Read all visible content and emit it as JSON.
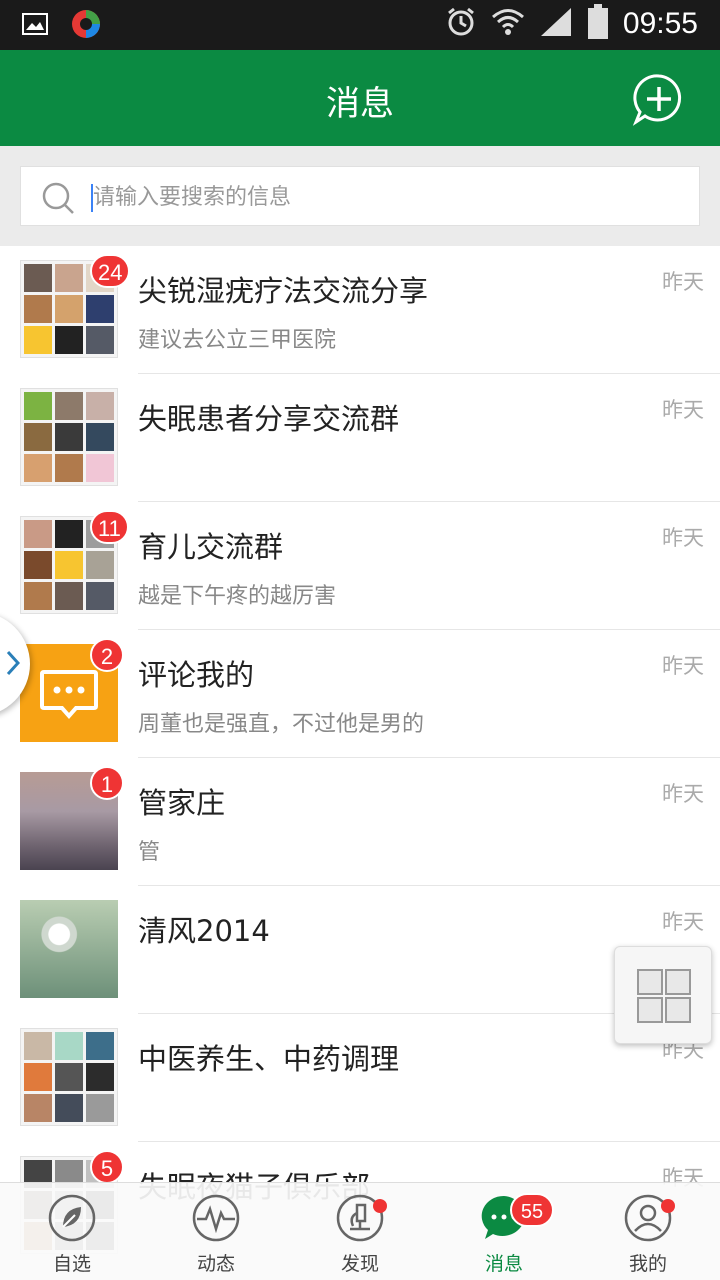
{
  "status_bar": {
    "time": "09:55"
  },
  "header": {
    "title": "消息"
  },
  "search": {
    "placeholder": "请输入要搜索的信息"
  },
  "conversations": [
    {
      "name": "尖锐湿疣疗法交流分享",
      "preview": "建议去公立三甲医院",
      "time": "昨天",
      "badge": "24",
      "avatar": "group"
    },
    {
      "name": "失眠患者分享交流群",
      "preview": "",
      "time": "昨天",
      "badge": "",
      "avatar": "group"
    },
    {
      "name": "育儿交流群",
      "preview": "越是下午疼的越厉害",
      "time": "昨天",
      "badge": "11",
      "avatar": "group"
    },
    {
      "name": "评论我的",
      "preview": "周董也是强直，不过他是男的",
      "time": "昨天",
      "badge": "2",
      "avatar": "comment-icon"
    },
    {
      "name": "管家庄",
      "preview": "管",
      "time": "昨天",
      "badge": "1",
      "avatar": "photo"
    },
    {
      "name": "清风2014",
      "preview": "",
      "time": "昨天",
      "badge": "",
      "avatar": "photo"
    },
    {
      "name": "中医养生、中药调理",
      "preview": "",
      "time": "昨天",
      "badge": "",
      "avatar": "group"
    },
    {
      "name": "失眠夜猫子俱乐部",
      "preview": "",
      "time": "昨天",
      "badge": "5",
      "avatar": "group"
    }
  ],
  "bottom_nav": [
    {
      "label": "自选",
      "icon": "leaf-icon"
    },
    {
      "label": "动态",
      "icon": "pulse-icon"
    },
    {
      "label": "发现",
      "icon": "microscope-icon",
      "dot": true
    },
    {
      "label": "消息",
      "icon": "chat-icon",
      "badge": "55",
      "active": true
    },
    {
      "label": "我的",
      "icon": "user-icon",
      "dot": true
    }
  ],
  "colors": {
    "brand_green": "#0b8a42",
    "badge_red": "#ef3434",
    "comment_orange": "#f7a213"
  }
}
